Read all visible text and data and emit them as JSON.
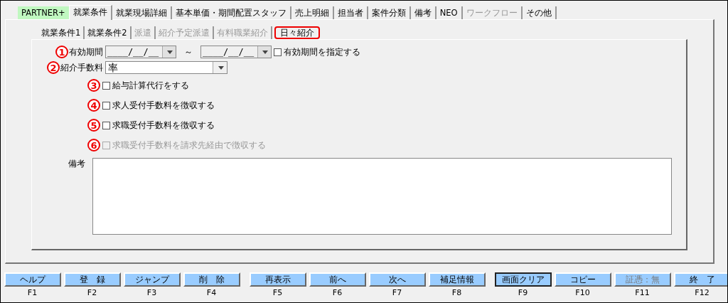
{
  "product_badge": {
    "label": "PARTNER+"
  },
  "top_tabs": [
    {
      "label": "就業条件",
      "selected": true,
      "disabled": false
    },
    {
      "label": "就業現場詳細",
      "selected": false,
      "disabled": false
    },
    {
      "label": "基本単価・期間配置スタッフ",
      "selected": false,
      "disabled": false
    },
    {
      "label": "売上明細",
      "selected": false,
      "disabled": false
    },
    {
      "label": "担当者",
      "selected": false,
      "disabled": false
    },
    {
      "label": "案件分類",
      "selected": false,
      "disabled": false
    },
    {
      "label": "備考",
      "selected": false,
      "disabled": false
    },
    {
      "label": "NEO",
      "selected": false,
      "disabled": false
    },
    {
      "label": "ワークフロー",
      "selected": false,
      "disabled": true
    },
    {
      "label": "その他",
      "selected": false,
      "disabled": false
    }
  ],
  "sub_tabs": [
    {
      "label": "就業条件1",
      "selected": false,
      "disabled": false
    },
    {
      "label": "就業条件2",
      "selected": false,
      "disabled": false
    },
    {
      "label": "派遣",
      "selected": false,
      "disabled": true
    },
    {
      "label": "紹介予定派遣",
      "selected": false,
      "disabled": true
    },
    {
      "label": "有料職業紹介",
      "selected": false,
      "disabled": true
    },
    {
      "label": "日々紹介",
      "selected": true,
      "disabled": false
    }
  ],
  "period": {
    "marker": "1",
    "label": "有効期間",
    "from": "____/__/__",
    "separator": "～",
    "to": "____/__/__",
    "checkbox": {
      "label": "有効期間を指定する",
      "checked": false
    }
  },
  "fee": {
    "marker": "2",
    "label": "紹介手数料",
    "value": "率"
  },
  "options": [
    {
      "marker": "3",
      "label": "給与計算代行をする",
      "checked": false,
      "disabled": false
    },
    {
      "marker": "4",
      "label": "求人受付手数料を徴収する",
      "checked": false,
      "disabled": false
    },
    {
      "marker": "5",
      "label": "求職受付手数料を徴収する",
      "checked": false,
      "disabled": false
    },
    {
      "marker": "6",
      "label": "求職受付手数料を請求先経由で徴収する",
      "checked": false,
      "disabled": true
    }
  ],
  "remarks": {
    "label": "備考"
  },
  "buttons": [
    {
      "label": "ヘルプ",
      "key": "F1",
      "disabled": false,
      "focused": false
    },
    {
      "label": "登　録",
      "key": "F2",
      "disabled": false,
      "focused": false
    },
    {
      "label": "ジャンプ",
      "key": "F3",
      "disabled": false,
      "focused": false
    },
    {
      "label": "削　除",
      "key": "F4",
      "disabled": false,
      "focused": false
    },
    {
      "label": "再表示",
      "key": "F5",
      "disabled": false,
      "focused": false
    },
    {
      "label": "前へ",
      "key": "F6",
      "disabled": false,
      "focused": false
    },
    {
      "label": "次へ",
      "key": "F7",
      "disabled": false,
      "focused": false
    },
    {
      "label": "補足情報",
      "key": "F8",
      "disabled": false,
      "focused": false
    },
    {
      "label": "画面クリア",
      "key": "F9",
      "disabled": false,
      "focused": true
    },
    {
      "label": "コピー",
      "key": "F10",
      "disabled": false,
      "focused": false
    },
    {
      "label": "証憑：無",
      "key": "F11",
      "disabled": true,
      "focused": false
    },
    {
      "label": "終　了",
      "key": "F12",
      "disabled": false,
      "focused": false
    }
  ]
}
